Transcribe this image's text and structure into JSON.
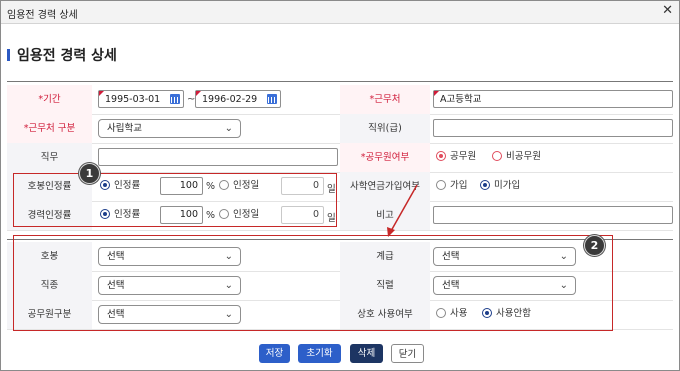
{
  "window": {
    "title": "임용전 경력 상세",
    "close_icon": "close-icon"
  },
  "heading": "임용전 경력 상세",
  "form": {
    "period": {
      "label": "*기간",
      "start": "1995-03-01",
      "end": "1996-02-29",
      "tilde": "~"
    },
    "workplace": {
      "label": "*근무처",
      "value": "A고등학교"
    },
    "workplace_type": {
      "label": "*근무처 구분",
      "value": "사립학교"
    },
    "position": {
      "label": "직위(급)",
      "value": ""
    },
    "duty": {
      "label": "직무",
      "value": ""
    },
    "civil_servant": {
      "label": "*공무원여부",
      "options": [
        "공무원",
        "비공무원"
      ],
      "selected": "공무원"
    },
    "salary_rate": {
      "label": "호봉인정률",
      "opt_rate": "인정률",
      "rate": "100",
      "pct": "%",
      "opt_day": "인정일",
      "days": "0",
      "day_unit": "일"
    },
    "pension": {
      "label": "사학연금가입여부",
      "options": [
        "가입",
        "미가입"
      ],
      "selected": "미가입"
    },
    "career_rate": {
      "label": "경력인정률",
      "opt_rate": "인정률",
      "rate": "100",
      "pct": "%",
      "opt_day": "인정일",
      "days": "0",
      "day_unit": "일"
    },
    "note": {
      "label": "비고",
      "value": ""
    }
  },
  "section2": {
    "grade_step": {
      "label": "호봉",
      "value": "선택"
    },
    "rank": {
      "label": "계급",
      "value": "선택"
    },
    "job_type": {
      "label": "직종",
      "value": "선택"
    },
    "series": {
      "label": "직렬",
      "value": "선택"
    },
    "civil_type": {
      "label": "공무원구분",
      "value": "선택"
    },
    "interchange": {
      "label": "상호 사용여부",
      "options": [
        "사용",
        "사용안함"
      ],
      "selected": "사용안함"
    }
  },
  "annotations": {
    "badge1": "1",
    "badge2": "2",
    "color": "#c62828"
  },
  "buttons": {
    "save": "저장",
    "reset": "초기화",
    "delete": "삭제",
    "close": "닫기"
  }
}
